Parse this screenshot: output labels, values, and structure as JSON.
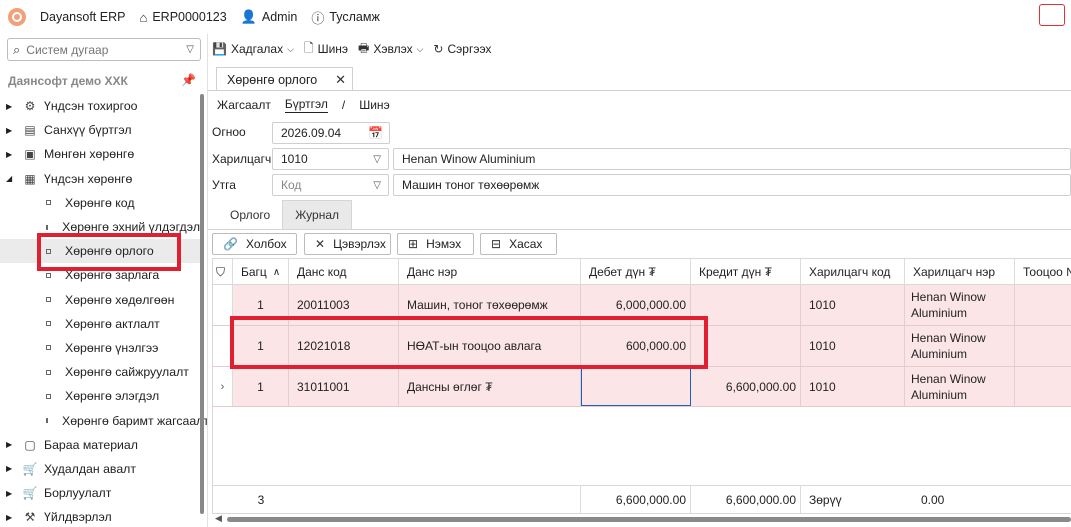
{
  "topbar": {
    "app_name": "Dayansoft ERP",
    "erp_id": "ERP0000123",
    "user": "Admin",
    "help": "Тусламж"
  },
  "sidebar": {
    "search_placeholder": "Систем дугаар",
    "company": "Даянсофт демо ХХК",
    "items": [
      {
        "label": "Үндсэн тохиргоо",
        "icon": "gear-icon",
        "level": 0
      },
      {
        "label": "Санхүү бүртгэл",
        "icon": "ledger-icon",
        "level": 0
      },
      {
        "label": "Мөнгөн хөрөнгө",
        "icon": "cash-icon",
        "level": 0
      },
      {
        "label": "Үндсэн хөрөнгө",
        "icon": "building-icon",
        "level": 0,
        "expanded": true
      },
      {
        "label": "Хөрөнгө код",
        "level": 1
      },
      {
        "label": "Хөрөнгө эхний үлдэгдэл",
        "level": 1
      },
      {
        "label": "Хөрөнгө орлого",
        "level": 1,
        "selected": true
      },
      {
        "label": "Хөрөнгө зарлага",
        "level": 1
      },
      {
        "label": "Хөрөнгө хөдөлгөөн",
        "level": 1
      },
      {
        "label": "Хөрөнгө актлалт",
        "level": 1
      },
      {
        "label": "Хөрөнгө үнэлгээ",
        "level": 1
      },
      {
        "label": "Хөрөнгө сайжруулалт",
        "level": 1
      },
      {
        "label": "Хөрөнгө элэгдэл",
        "level": 1
      },
      {
        "label": "Хөрөнгө баримт жагсаалт",
        "level": 1
      },
      {
        "label": "Бараа материал",
        "icon": "box-icon",
        "level": 0
      },
      {
        "label": "Худалдан авалт",
        "icon": "cart-icon",
        "level": 0
      },
      {
        "label": "Борлуулалт",
        "icon": "sale-cart-icon",
        "level": 0
      },
      {
        "label": "Үйлдвэрлэл",
        "icon": "factory-icon",
        "level": 0
      }
    ]
  },
  "toolbar": {
    "save": "Хадгалах",
    "new": "Шинэ",
    "print": "Хэвлэх",
    "refresh": "Сэргээх"
  },
  "tab": {
    "title": "Хөрөнгө орлого"
  },
  "breadcrumb": {
    "list": "Жагсаалт",
    "register": "Бүртгэл",
    "sep": "/",
    "new": "Шинэ"
  },
  "form": {
    "date_label": "Огноо",
    "date_value": "2026.09.04",
    "partner_label": "Харилцагч",
    "partner_code": "1010",
    "partner_name": "Henan Winow Aluminium",
    "purpose_label": "Утга",
    "purpose_code_placeholder": "Код",
    "purpose_text": "Машин тоног төхөөрөмж"
  },
  "subtabs": {
    "income": "Орлого",
    "journal": "Журнал"
  },
  "grid_toolbar": {
    "link": "Холбох",
    "clear": "Цэвэрлэх",
    "add": "Нэмэх",
    "remove": "Хасах"
  },
  "grid": {
    "columns": [
      "Багц",
      "Данс код",
      "Данс нэр",
      "Дебет дүн ₮",
      "Кредит дүн ₮",
      "Харилцагч код",
      "Харилцагч нэр",
      "Тооцоо №"
    ],
    "rows": [
      {
        "batch": "1",
        "acct_code": "20011003",
        "acct_name": "Машин, тоног төхөөрөмж",
        "debit": "6,000,000.00",
        "credit": "",
        "partner_code": "1010",
        "partner_name": "Henan Winow Aluminium"
      },
      {
        "batch": "1",
        "acct_code": "12021018",
        "acct_name": "НӨАТ-ын тооцоо авлага",
        "debit": "600,000.00",
        "credit": "",
        "partner_code": "1010",
        "partner_name": "Henan Winow Aluminium"
      },
      {
        "batch": "1",
        "acct_code": "31011001",
        "acct_name": "Дансны өглөг ₮",
        "debit": "",
        "credit": "6,600,000.00",
        "partner_code": "1010",
        "partner_name": "Henan Winow Aluminium"
      }
    ],
    "footer": {
      "count": "3",
      "debit_total": "6,600,000.00",
      "credit_total": "6,600,000.00",
      "diff_label": "Зөрүү",
      "diff_value": "0.00"
    }
  },
  "colors": {
    "row_bg": "#fce5e7",
    "highlight": "#e02030",
    "focus_cell": "#1f5fbf"
  }
}
